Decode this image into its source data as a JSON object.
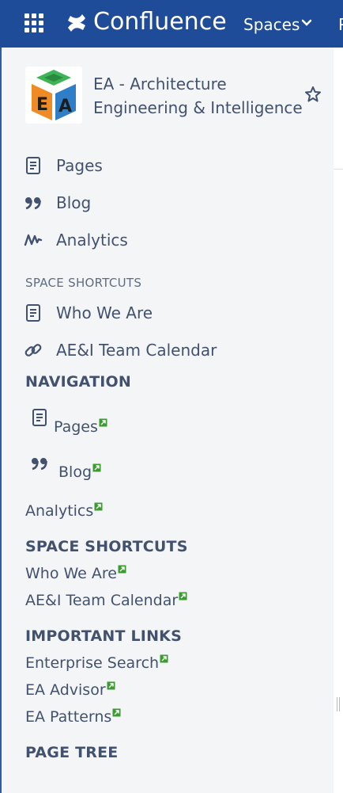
{
  "header": {
    "brand": "Confluence",
    "spaces_label": "Spaces",
    "next_nav_partial": "P"
  },
  "space": {
    "name_line1": "EA - Architecture",
    "name_line2": "Engineering & Intelligence",
    "logo_letters": "EA"
  },
  "sidebar_nav": [
    {
      "label": "Pages",
      "icon": "page-icon"
    },
    {
      "label": "Blog",
      "icon": "quote-icon"
    },
    {
      "label": "Analytics",
      "icon": "analytics-icon"
    }
  ],
  "shortcuts": {
    "heading": "SPACE SHORTCUTS",
    "items": [
      {
        "label": "Who We Are",
        "icon": "page-icon"
      },
      {
        "label": "AE&I Team Calendar",
        "icon": "link-icon"
      }
    ]
  },
  "custom_nav": {
    "navigation_heading": "NAVIGATION",
    "pages_label": "Pages",
    "blog_label": "Blog",
    "analytics_label": "Analytics",
    "space_shortcuts_heading": "SPACE SHORTCUTS",
    "who_we_are_label": "Who We Are",
    "team_calendar_label": "AE&I Team Calendar",
    "important_links_heading": "IMPORTANT LINKS",
    "enterprise_search_label": "Enterprise Search",
    "ea_advisor_label": "EA Advisor",
    "ea_patterns_label": "EA Patterns",
    "page_tree_heading": "PAGE TREE"
  },
  "colors": {
    "topbar": "#1f4c98",
    "sidebar_bg": "#f4f5f7",
    "text": "#42526e",
    "external_link_icon": "#3a9b2f"
  }
}
